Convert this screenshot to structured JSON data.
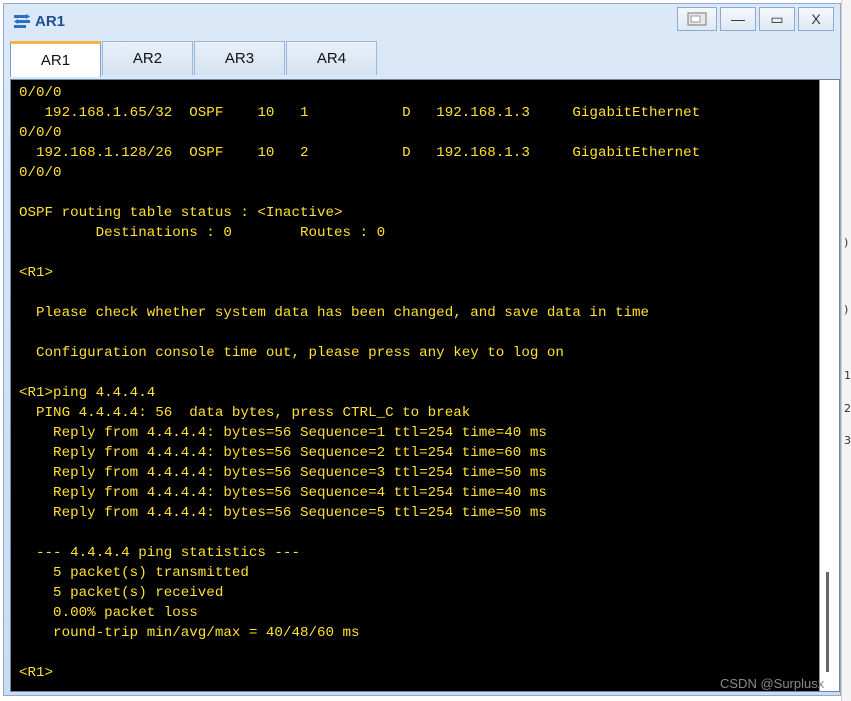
{
  "window": {
    "title": "AR1",
    "controls": {
      "restore_icon": "restore-icon",
      "minimize": "—",
      "maximize": "▭",
      "close": "X"
    }
  },
  "tabs": [
    {
      "label": "AR1",
      "active": true
    },
    {
      "label": "AR2",
      "active": false
    },
    {
      "label": "AR3",
      "active": false
    },
    {
      "label": "AR4",
      "active": false
    }
  ],
  "console": {
    "text_color": "#ffe033",
    "background": "#000000",
    "lines": [
      "0/0/0",
      "   192.168.1.65/32  OSPF    10   1           D   192.168.1.3     GigabitEthernet",
      "0/0/0",
      "  192.168.1.128/26  OSPF    10   2           D   192.168.1.3     GigabitEthernet",
      "0/0/0",
      "",
      "OSPF routing table status : <Inactive>",
      "         Destinations : 0        Routes : 0",
      "",
      "<R1>",
      "",
      "  Please check whether system data has been changed, and save data in time",
      "",
      "  Configuration console time out, please press any key to log on",
      "",
      "<R1>ping 4.4.4.4",
      "  PING 4.4.4.4: 56  data bytes, press CTRL_C to break",
      "    Reply from 4.4.4.4: bytes=56 Sequence=1 ttl=254 time=40 ms",
      "    Reply from 4.4.4.4: bytes=56 Sequence=2 ttl=254 time=60 ms",
      "    Reply from 4.4.4.4: bytes=56 Sequence=3 ttl=254 time=50 ms",
      "    Reply from 4.4.4.4: bytes=56 Sequence=4 ttl=254 time=40 ms",
      "    Reply from 4.4.4.4: bytes=56 Sequence=5 ttl=254 time=50 ms",
      "",
      "  --- 4.4.4.4 ping statistics ---",
      "    5 packet(s) transmitted",
      "    5 packet(s) received",
      "    0.00% packet loss",
      "    round-trip min/avg/max = 40/48/60 ms",
      "",
      "<R1>"
    ]
  },
  "background_edge_labels": [
    ")",
    ")",
    "1",
    "2",
    "3"
  ],
  "watermark": "CSDN @Surplusx"
}
